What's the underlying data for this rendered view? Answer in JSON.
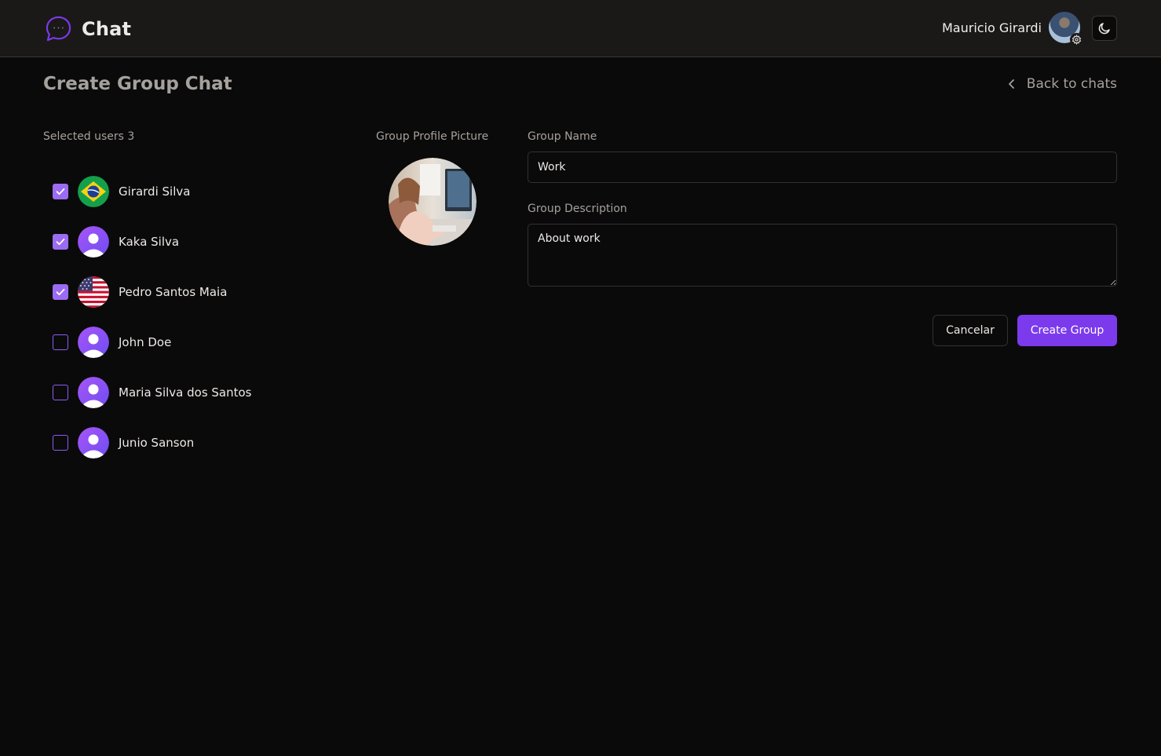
{
  "header": {
    "app_title": "Chat",
    "user_name": "Mauricio Girardi"
  },
  "page": {
    "title": "Create Group Chat",
    "back_label": "Back to chats"
  },
  "selection": {
    "label": "Selected users 3",
    "users": [
      {
        "name": "Girardi Silva",
        "checked": true,
        "avatar": "brazil-flag-icon"
      },
      {
        "name": "Kaka Silva",
        "checked": true,
        "avatar": "default-user-avatar"
      },
      {
        "name": "Pedro Santos Maia",
        "checked": true,
        "avatar": "usa-flag-icon"
      },
      {
        "name": "John Doe",
        "checked": false,
        "avatar": "default-user-avatar"
      },
      {
        "name": "Maria Silva dos Santos",
        "checked": false,
        "avatar": "default-user-avatar"
      },
      {
        "name": "Junio Sanson",
        "checked": false,
        "avatar": "default-user-avatar"
      }
    ]
  },
  "group": {
    "picture_label": "Group Profile Picture",
    "name_label": "Group Name",
    "name_value": "Work",
    "description_label": "Group Description",
    "description_value": "About work"
  },
  "actions": {
    "cancel_label": "Cancelar",
    "create_label": "Create Group"
  },
  "colors": {
    "accent": "#7c3aed",
    "checkbox": "#9b6cf2",
    "background": "#0b0a0a",
    "topbar": "#1b1918"
  }
}
